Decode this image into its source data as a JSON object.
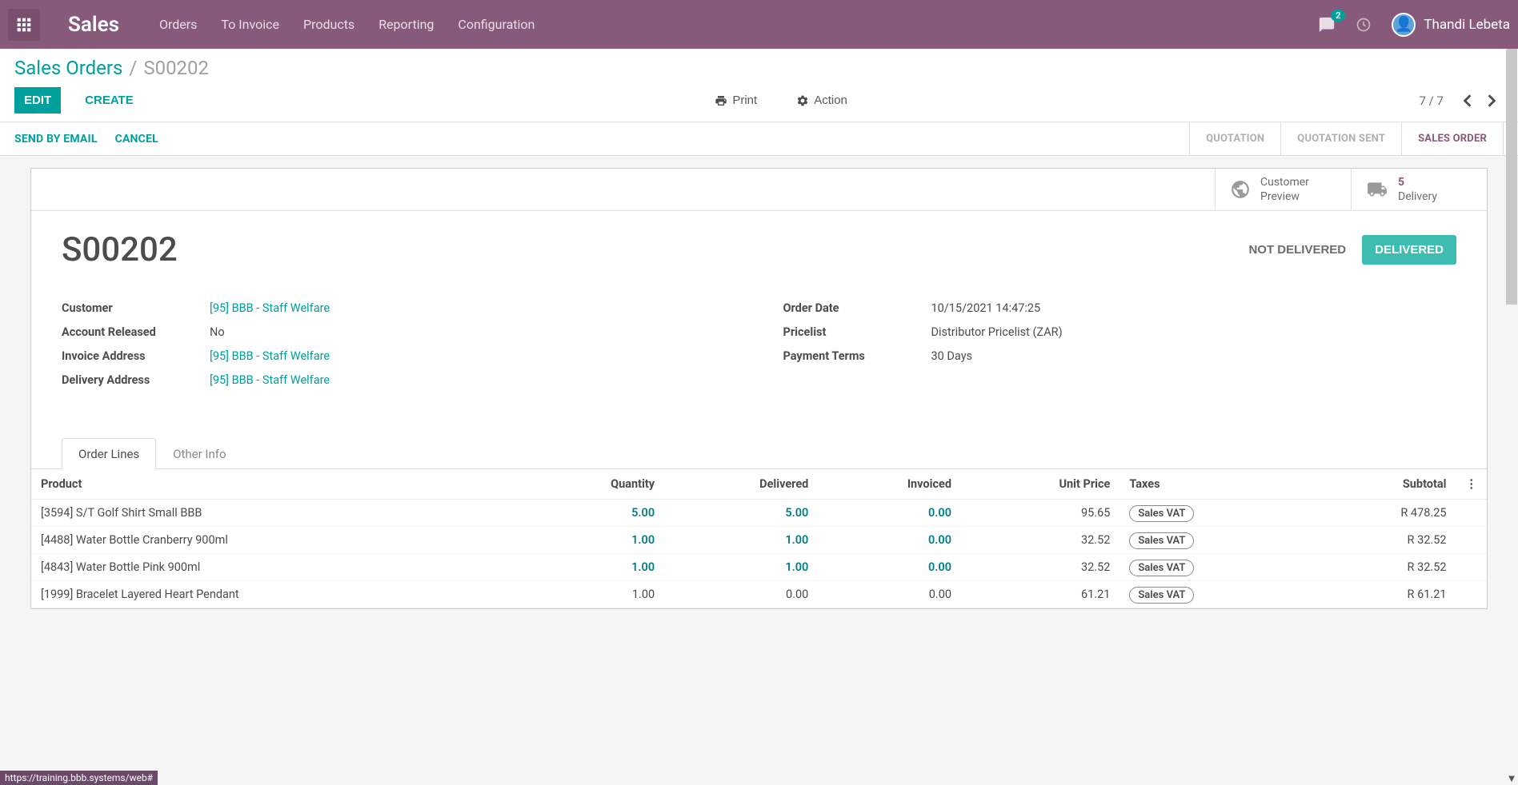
{
  "navbar": {
    "brand": "Sales",
    "items": [
      "Orders",
      "To Invoice",
      "Products",
      "Reporting",
      "Configuration"
    ],
    "chat_badge": "2",
    "user_name": "Thandi Lebeta"
  },
  "breadcrumb": {
    "parent": "Sales Orders",
    "current": "S00202"
  },
  "buttons": {
    "edit": "EDIT",
    "create": "CREATE",
    "print": "Print",
    "action": "Action",
    "send_email": "SEND BY EMAIL",
    "cancel": "CANCEL"
  },
  "pager": "7 / 7",
  "status_steps": {
    "quotation": "QUOTATION",
    "quotation_sent": "QUOTATION SENT",
    "sales_order": "SALES ORDER"
  },
  "smart_buttons": {
    "preview_label": "Customer",
    "preview_label2": "Preview",
    "delivery_count": "5",
    "delivery_label": "Delivery"
  },
  "order": {
    "name": "S00202",
    "not_delivered": "NOT DELIVERED",
    "delivered": "DELIVERED",
    "labels": {
      "customer": "Customer",
      "account_released": "Account Released",
      "invoice_address": "Invoice Address",
      "delivery_address": "Delivery Address",
      "order_date": "Order Date",
      "pricelist": "Pricelist",
      "payment_terms": "Payment Terms"
    },
    "values": {
      "customer": "[95] BBB - Staff Welfare",
      "account_released": "No",
      "invoice_address": "[95] BBB - Staff Welfare",
      "delivery_address": "[95] BBB - Staff Welfare",
      "order_date": "10/15/2021 14:47:25",
      "pricelist": "Distributor Pricelist (ZAR)",
      "payment_terms": "30 Days"
    }
  },
  "tabs": {
    "order_lines": "Order Lines",
    "other_info": "Other Info"
  },
  "table": {
    "headers": {
      "product": "Product",
      "quantity": "Quantity",
      "delivered": "Delivered",
      "invoiced": "Invoiced",
      "unit_price": "Unit Price",
      "taxes": "Taxes",
      "subtotal": "Subtotal"
    },
    "tax_label": "Sales VAT",
    "rows": [
      {
        "product": "[3594] S/T Golf Shirt Small BBB",
        "qty": "5.00",
        "delivered": "5.00",
        "invoiced": "0.00",
        "unit_price": "95.65",
        "subtotal": "R 478.25",
        "teal": true
      },
      {
        "product": "[4488] Water Bottle Cranberry 900ml",
        "qty": "1.00",
        "delivered": "1.00",
        "invoiced": "0.00",
        "unit_price": "32.52",
        "subtotal": "R 32.52",
        "teal": true
      },
      {
        "product": "[4843] Water Bottle Pink 900ml",
        "qty": "1.00",
        "delivered": "1.00",
        "invoiced": "0.00",
        "unit_price": "32.52",
        "subtotal": "R 32.52",
        "teal": true
      },
      {
        "product": "[1999] Bracelet Layered Heart Pendant",
        "qty": "1.00",
        "delivered": "0.00",
        "invoiced": "0.00",
        "unit_price": "61.21",
        "subtotal": "R 61.21",
        "teal": false
      }
    ]
  },
  "footer_url": "https://training.bbb.systems/web#"
}
